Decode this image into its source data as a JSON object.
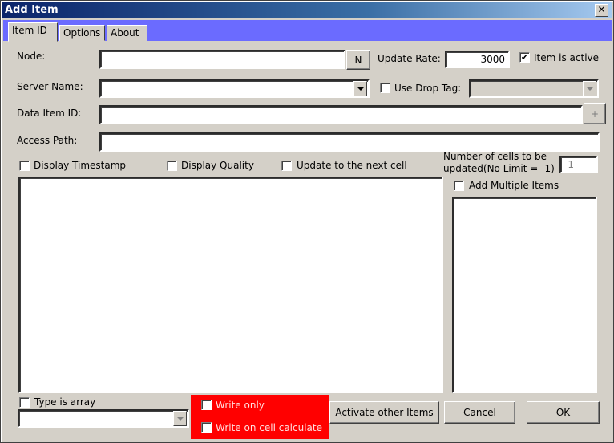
{
  "window": {
    "title": "Add Item",
    "close_glyph": "✕"
  },
  "tabs": [
    {
      "label": "Item ID"
    },
    {
      "label": "Options"
    },
    {
      "label": "About"
    }
  ],
  "node": {
    "label": "Node:",
    "value": "",
    "button_label": "N"
  },
  "update_rate": {
    "label": "Update Rate:",
    "value": "3000"
  },
  "item_is_active": {
    "label": "Item is active",
    "checked": true
  },
  "server_name": {
    "label": "Server Name:",
    "value": ""
  },
  "use_drop_tag": {
    "label": "Use Drop Tag:",
    "checked": false,
    "value": ""
  },
  "data_item_id": {
    "label": "Data Item ID:",
    "value": "",
    "add_button": "+"
  },
  "access_path": {
    "label": "Access Path:",
    "value": ""
  },
  "display_timestamp": {
    "label": "Display Timestamp",
    "checked": false
  },
  "display_quality": {
    "label": "Display Quality",
    "checked": false
  },
  "update_next_cell": {
    "label": "Update to the next cell",
    "checked": false
  },
  "num_cells": {
    "label_line1": "Number of cells to be",
    "label_line2": "updated(No Limit = -1)",
    "value": "-1"
  },
  "add_multiple": {
    "label": "Add Multiple Items",
    "checked": false
  },
  "type_is_array": {
    "label": "Type is array",
    "checked": false,
    "value": ""
  },
  "write_only": {
    "label": "Write only",
    "checked": false
  },
  "write_on_calc": {
    "label": "Write on cell calculate",
    "checked": false
  },
  "buttons": {
    "activate": "Activate other Items",
    "cancel": "Cancel",
    "ok": "OK"
  },
  "colors": {
    "title_bar": "#0a246a",
    "tab_strip": "#6b6bff",
    "highlight_panel": "#ff0000",
    "dialog_bg": "#d4d0c8"
  }
}
